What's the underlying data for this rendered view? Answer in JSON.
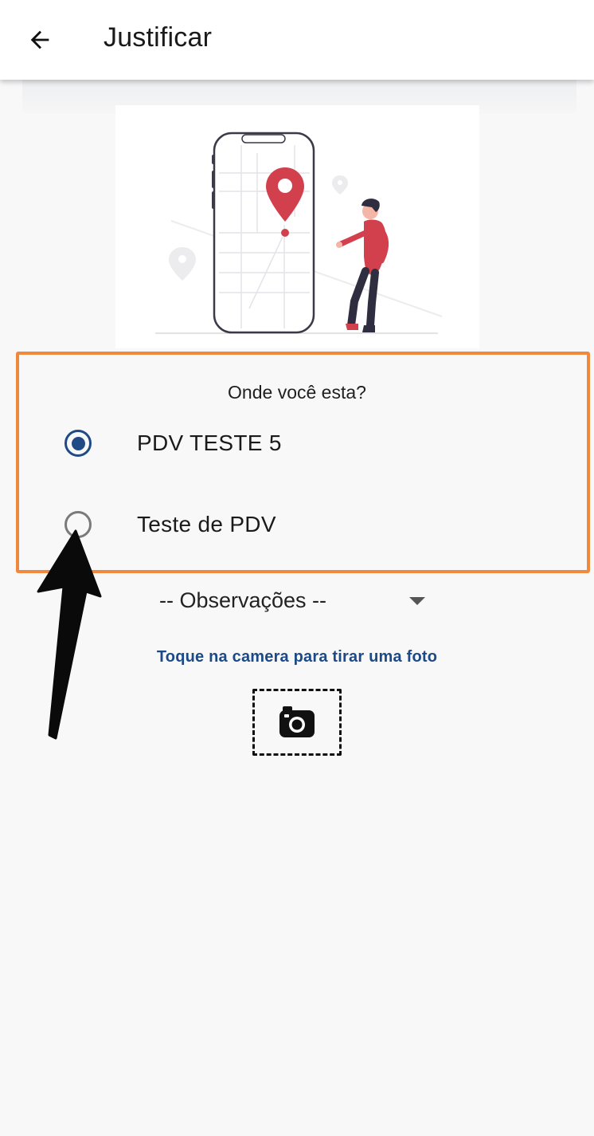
{
  "appbar": {
    "title": "Justificar",
    "back_icon": "arrow-left-icon"
  },
  "illustration": {
    "subject": "phone-with-map-location-pin-and-person",
    "accent_color": "#d2404e"
  },
  "location_question": {
    "label": "Onde você esta?",
    "options": [
      {
        "label": "PDV TESTE 5",
        "selected": true
      },
      {
        "label": "Teste de PDV",
        "selected": false
      }
    ],
    "highlight_color": "#f0883d"
  },
  "observations_select": {
    "value": "-- Observações --",
    "icon": "caret-down-icon"
  },
  "camera": {
    "hint": "Toque na camera para tirar uma foto",
    "icon": "camera-icon"
  },
  "colors": {
    "primary": "#1f4a86",
    "background": "#f8f8f9"
  }
}
